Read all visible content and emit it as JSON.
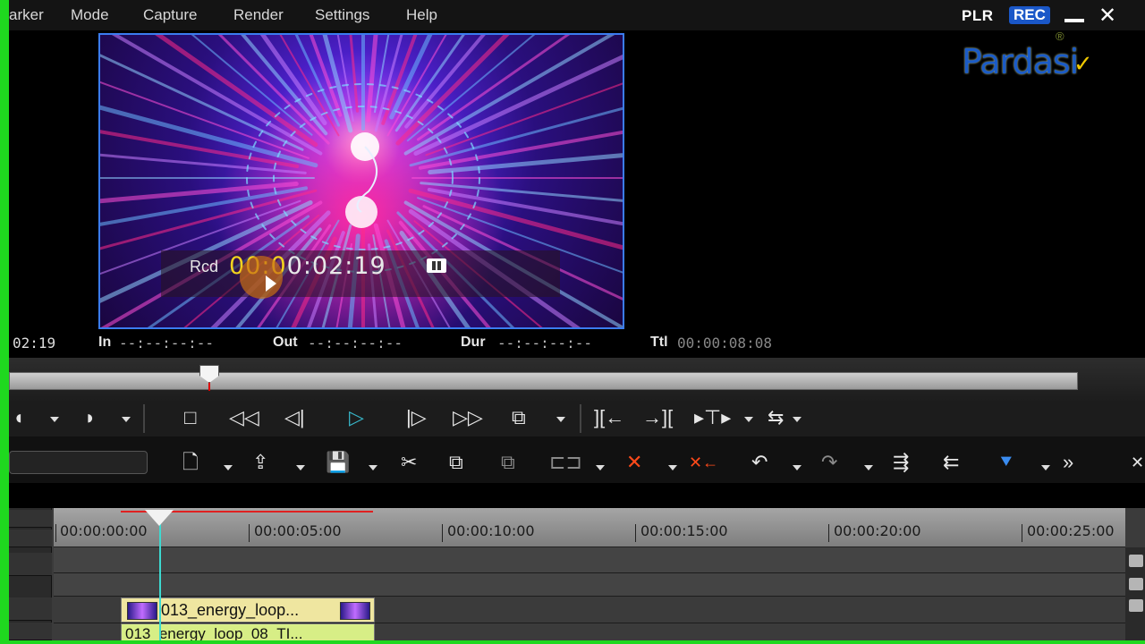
{
  "menu": {
    "items": [
      "arker",
      "Mode",
      "Capture",
      "Render",
      "Settings",
      "Help"
    ]
  },
  "recorder": {
    "plr": "PLR",
    "rec": "REC"
  },
  "window": {
    "minimize_icon": "minimize-icon",
    "close_icon": "close-icon",
    "close_glyph": "✕"
  },
  "logo": {
    "text": "Pardasi",
    "reg": "®",
    "check": "✓"
  },
  "preview": {
    "rcd_label": "Rcd",
    "timecode_active": "00:0",
    "timecode_rest": "0:02:19",
    "left_time": "02:19",
    "in_label": "In",
    "in_value": "--:--:--:--",
    "out_label": "Out",
    "out_value": "--:--:--:--",
    "dur_label": "Dur",
    "dur_value": "--:--:--:--",
    "ttl_label": "Ttl",
    "ttl_value": "00:00:08:08"
  },
  "transport": {
    "buttons": [
      "◖",
      "◗",
      "□",
      "◁◁",
      "◁|",
      "▷",
      "|▷",
      "▷▷",
      "⧉",
      "][←",
      "→][",
      "▸⊤▸",
      "⇆"
    ]
  },
  "edit_toolbar": {
    "buttons": [
      "🗋",
      "⇪",
      "💾",
      "✂",
      "⧉",
      "⧉",
      "⊏⊐",
      "✕",
      "✕←",
      "↶",
      "↷",
      "⇶",
      "⇇",
      "⯆",
      "»",
      "✕"
    ]
  },
  "timeline": {
    "ruler_labels": [
      "00:00:00:00",
      "00:00:05:00",
      "00:00:10:00",
      "00:00:15:00",
      "00:00:20:00",
      "00:00:25:00"
    ],
    "clip_top_label": "013_energy_loop...",
    "clip_bottom_label": "013_energy_loop_08_TI..."
  }
}
